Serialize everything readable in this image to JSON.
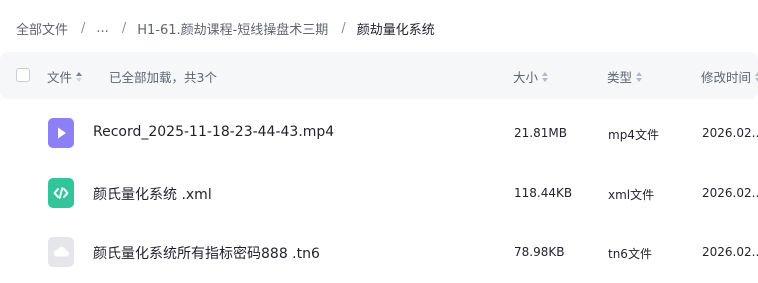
{
  "breadcrumb": {
    "root": "全部文件",
    "ellipsis": "...",
    "parent": "H1-61.颜劫课程-短线操盘术三期",
    "current": "颜劫量化系统",
    "separator": "/"
  },
  "table": {
    "columns": {
      "name": "文件",
      "loaded_status": "已全部加载，共3个",
      "size": "大小",
      "type": "类型",
      "modified": "修改时间"
    },
    "rows": [
      {
        "icon": "video-file-icon",
        "icon_color": "#8d7ff5",
        "name": "Record_2025-11-18-23-44-43.mp4",
        "size": "21.81MB",
        "type": "mp4文件",
        "modified": "2026.02..."
      },
      {
        "icon": "code-file-icon",
        "icon_color": "#32c49a",
        "name": "颜氏量化系统 .xml",
        "size": "118.44KB",
        "type": "xml文件",
        "modified": "2026.02..."
      },
      {
        "icon": "cloud-file-icon",
        "icon_color": "#e4e6ea",
        "name": "颜氏量化系统所有指标密码888 .tn6",
        "size": "78.98KB",
        "type": "tn6文件",
        "modified": "2026.02..."
      }
    ]
  }
}
